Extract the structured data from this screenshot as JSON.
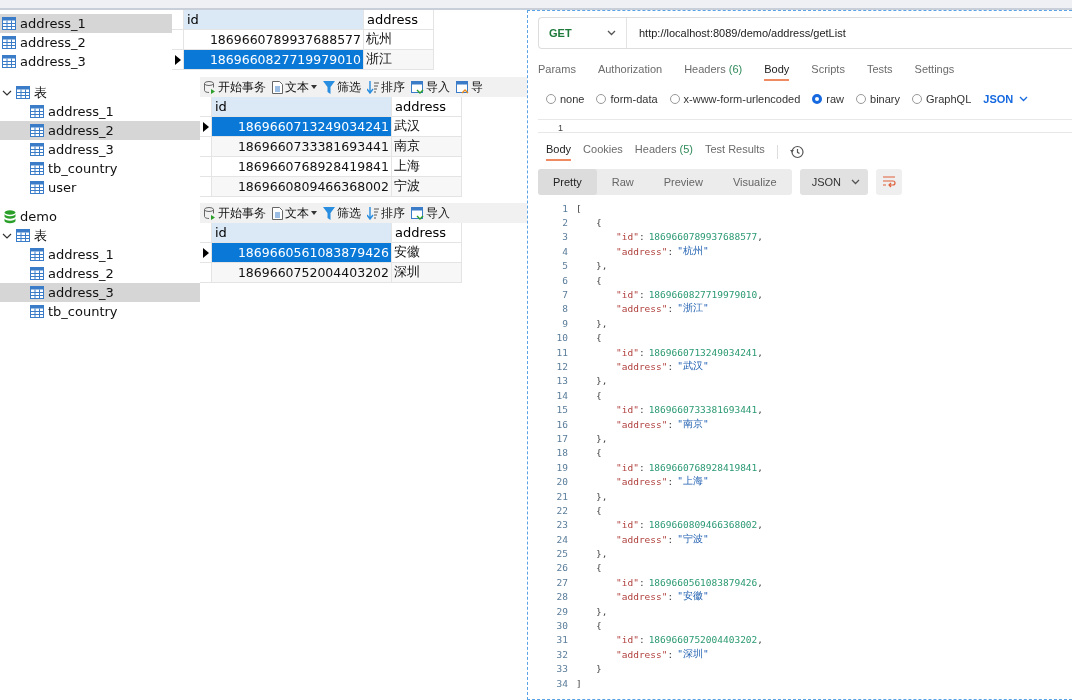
{
  "navicat_panels": [
    {
      "tables": [
        {
          "name": "address_1",
          "selected": true
        },
        {
          "name": "address_2",
          "selected": false
        },
        {
          "name": "address_3",
          "selected": false
        }
      ],
      "columns": [
        "id",
        "address"
      ],
      "rows": [
        {
          "id": "1869660789937688577",
          "address": "杭州",
          "selected": false
        },
        {
          "id": "1869660827719979010",
          "address": "浙江",
          "selected": true
        }
      ]
    },
    {
      "folder": {
        "label": "表",
        "expanded": true
      },
      "tables": [
        {
          "name": "address_1",
          "selected": false
        },
        {
          "name": "address_2",
          "selected": true
        },
        {
          "name": "address_3",
          "selected": false
        },
        {
          "name": "tb_country",
          "selected": false
        },
        {
          "name": "user",
          "selected": false
        }
      ],
      "toolbar": [
        {
          "kind": "transaction",
          "label": "开始事务"
        },
        {
          "kind": "text",
          "label": "文本"
        },
        {
          "kind": "filter",
          "label": "筛选"
        },
        {
          "kind": "sort",
          "label": "排序"
        },
        {
          "kind": "import",
          "label": "导入"
        },
        {
          "kind": "export",
          "label": "导"
        }
      ],
      "columns": [
        "id",
        "address"
      ],
      "rows": [
        {
          "id": "1869660713249034241",
          "address": "武汉",
          "selected": true
        },
        {
          "id": "1869660733381693441",
          "address": "南京",
          "selected": false
        },
        {
          "id": "1869660768928419841",
          "address": "上海",
          "selected": false
        },
        {
          "id": "1869660809466368002",
          "address": "宁波",
          "selected": false
        }
      ]
    },
    {
      "database": "demo",
      "folder": {
        "label": "表",
        "expanded": true
      },
      "tables": [
        {
          "name": "address_1",
          "selected": false
        },
        {
          "name": "address_2",
          "selected": false
        },
        {
          "name": "address_3",
          "selected": true
        },
        {
          "name": "tb_country",
          "selected": false
        }
      ],
      "toolbar": [
        {
          "kind": "transaction",
          "label": "开始事务"
        },
        {
          "kind": "text",
          "label": "文本"
        },
        {
          "kind": "filter",
          "label": "筛选"
        },
        {
          "kind": "sort",
          "label": "排序"
        },
        {
          "kind": "import",
          "label": "导入"
        }
      ],
      "columns": [
        "id",
        "address"
      ],
      "rows": [
        {
          "id": "1869660561083879426",
          "address": "安徽",
          "selected": true
        },
        {
          "id": "1869660752004403202",
          "address": "深圳",
          "selected": false
        }
      ]
    }
  ],
  "postman": {
    "method": "GET",
    "url": "http://localhost:8089/demo/address/getList",
    "request_tabs": [
      {
        "label": "Params",
        "selected": false
      },
      {
        "label": "Authorization",
        "selected": false
      },
      {
        "label": "Headers",
        "count": "(6)",
        "selected": false
      },
      {
        "label": "Body",
        "selected": true
      },
      {
        "label": "Scripts",
        "selected": false
      },
      {
        "label": "Tests",
        "selected": false
      },
      {
        "label": "Settings",
        "selected": false
      }
    ],
    "body_types": [
      {
        "label": "none",
        "selected": false
      },
      {
        "label": "form-data",
        "selected": false
      },
      {
        "label": "x-www-form-urlencoded",
        "selected": false
      },
      {
        "label": "raw",
        "selected": true
      },
      {
        "label": "binary",
        "selected": false
      },
      {
        "label": "GraphQL",
        "selected": false
      }
    ],
    "body_format": "JSON",
    "editor_line": "1",
    "response_tabs": [
      {
        "label": "Body",
        "selected": true
      },
      {
        "label": "Cookies",
        "selected": false
      },
      {
        "label": "Headers",
        "count": "(5)",
        "selected": false
      },
      {
        "label": "Test Results",
        "selected": false
      }
    ],
    "view_modes": [
      {
        "label": "Pretty",
        "selected": true
      },
      {
        "label": "Raw",
        "selected": false
      },
      {
        "label": "Preview",
        "selected": false
      },
      {
        "label": "Visualize",
        "selected": false
      }
    ],
    "response_format": "JSON",
    "code": [
      {
        "no": "1",
        "kind": "outer",
        "parts": [
          {
            "kind": "punct",
            "text": "["
          }
        ]
      },
      {
        "no": "2",
        "kind": "object",
        "parts": [
          {
            "kind": "punct",
            "text": "{"
          }
        ]
      },
      {
        "no": "3",
        "kind": "field",
        "parts": [
          {
            "kind": "key",
            "text": "\"id\""
          },
          {
            "kind": "punct",
            "text": ":"
          },
          {
            "kind": "number",
            "text": "1869660789937688577"
          },
          {
            "kind": "punct",
            "text": ","
          }
        ]
      },
      {
        "no": "4",
        "kind": "field",
        "parts": [
          {
            "kind": "key",
            "text": "\"address\""
          },
          {
            "kind": "punct",
            "text": ":"
          },
          {
            "kind": "string",
            "text": "\"杭州\""
          }
        ]
      },
      {
        "no": "5",
        "kind": "object",
        "parts": [
          {
            "kind": "punct",
            "text": "},"
          }
        ]
      },
      {
        "no": "6",
        "kind": "object",
        "parts": [
          {
            "kind": "punct",
            "text": "{"
          }
        ]
      },
      {
        "no": "7",
        "kind": "field",
        "parts": [
          {
            "kind": "key",
            "text": "\"id\""
          },
          {
            "kind": "punct",
            "text": ":"
          },
          {
            "kind": "number",
            "text": "1869660827719979010"
          },
          {
            "kind": "punct",
            "text": ","
          }
        ]
      },
      {
        "no": "8",
        "kind": "field",
        "parts": [
          {
            "kind": "key",
            "text": "\"address\""
          },
          {
            "kind": "punct",
            "text": ":"
          },
          {
            "kind": "string",
            "text": "\"浙江\""
          }
        ]
      },
      {
        "no": "9",
        "kind": "object",
        "parts": [
          {
            "kind": "punct",
            "text": "},"
          }
        ]
      },
      {
        "no": "10",
        "kind": "object",
        "parts": [
          {
            "kind": "punct",
            "text": "{"
          }
        ]
      },
      {
        "no": "11",
        "kind": "field",
        "parts": [
          {
            "kind": "key",
            "text": "\"id\""
          },
          {
            "kind": "punct",
            "text": ":"
          },
          {
            "kind": "number",
            "text": "1869660713249034241"
          },
          {
            "kind": "punct",
            "text": ","
          }
        ]
      },
      {
        "no": "12",
        "kind": "field",
        "parts": [
          {
            "kind": "key",
            "text": "\"address\""
          },
          {
            "kind": "punct",
            "text": ":"
          },
          {
            "kind": "string",
            "text": "\"武汉\""
          }
        ]
      },
      {
        "no": "13",
        "kind": "object",
        "parts": [
          {
            "kind": "punct",
            "text": "},"
          }
        ]
      },
      {
        "no": "14",
        "kind": "object",
        "parts": [
          {
            "kind": "punct",
            "text": "{"
          }
        ]
      },
      {
        "no": "15",
        "kind": "field",
        "parts": [
          {
            "kind": "key",
            "text": "\"id\""
          },
          {
            "kind": "punct",
            "text": ":"
          },
          {
            "kind": "number",
            "text": "1869660733381693441"
          },
          {
            "kind": "punct",
            "text": ","
          }
        ]
      },
      {
        "no": "16",
        "kind": "field",
        "parts": [
          {
            "kind": "key",
            "text": "\"address\""
          },
          {
            "kind": "punct",
            "text": ":"
          },
          {
            "kind": "string",
            "text": "\"南京\""
          }
        ]
      },
      {
        "no": "17",
        "kind": "object",
        "parts": [
          {
            "kind": "punct",
            "text": "},"
          }
        ]
      },
      {
        "no": "18",
        "kind": "object",
        "parts": [
          {
            "kind": "punct",
            "text": "{"
          }
        ]
      },
      {
        "no": "19",
        "kind": "field",
        "parts": [
          {
            "kind": "key",
            "text": "\"id\""
          },
          {
            "kind": "punct",
            "text": ":"
          },
          {
            "kind": "number",
            "text": "1869660768928419841"
          },
          {
            "kind": "punct",
            "text": ","
          }
        ]
      },
      {
        "no": "20",
        "kind": "field",
        "parts": [
          {
            "kind": "key",
            "text": "\"address\""
          },
          {
            "kind": "punct",
            "text": ":"
          },
          {
            "kind": "string",
            "text": "\"上海\""
          }
        ]
      },
      {
        "no": "21",
        "kind": "object",
        "parts": [
          {
            "kind": "punct",
            "text": "},"
          }
        ]
      },
      {
        "no": "22",
        "kind": "object",
        "parts": [
          {
            "kind": "punct",
            "text": "{"
          }
        ]
      },
      {
        "no": "23",
        "kind": "field",
        "parts": [
          {
            "kind": "key",
            "text": "\"id\""
          },
          {
            "kind": "punct",
            "text": ":"
          },
          {
            "kind": "number",
            "text": "1869660809466368002"
          },
          {
            "kind": "punct",
            "text": ","
          }
        ]
      },
      {
        "no": "24",
        "kind": "field",
        "parts": [
          {
            "kind": "key",
            "text": "\"address\""
          },
          {
            "kind": "punct",
            "text": ":"
          },
          {
            "kind": "string",
            "text": "\"宁波\""
          }
        ]
      },
      {
        "no": "25",
        "kind": "object",
        "parts": [
          {
            "kind": "punct",
            "text": "},"
          }
        ]
      },
      {
        "no": "26",
        "kind": "object",
        "parts": [
          {
            "kind": "punct",
            "text": "{"
          }
        ]
      },
      {
        "no": "27",
        "kind": "field",
        "parts": [
          {
            "kind": "key",
            "text": "\"id\""
          },
          {
            "kind": "punct",
            "text": ":"
          },
          {
            "kind": "number",
            "text": "1869660561083879426"
          },
          {
            "kind": "punct",
            "text": ","
          }
        ]
      },
      {
        "no": "28",
        "kind": "field",
        "parts": [
          {
            "kind": "key",
            "text": "\"address\""
          },
          {
            "kind": "punct",
            "text": ":"
          },
          {
            "kind": "string",
            "text": "\"安徽\""
          }
        ]
      },
      {
        "no": "29",
        "kind": "object",
        "parts": [
          {
            "kind": "punct",
            "text": "},"
          }
        ]
      },
      {
        "no": "30",
        "kind": "object",
        "parts": [
          {
            "kind": "punct",
            "text": "{"
          }
        ]
      },
      {
        "no": "31",
        "kind": "field",
        "parts": [
          {
            "kind": "key",
            "text": "\"id\""
          },
          {
            "kind": "punct",
            "text": ":"
          },
          {
            "kind": "number",
            "text": "1869660752004403202"
          },
          {
            "kind": "punct",
            "text": ","
          }
        ]
      },
      {
        "no": "32",
        "kind": "field",
        "parts": [
          {
            "kind": "key",
            "text": "\"address\""
          },
          {
            "kind": "punct",
            "text": ":"
          },
          {
            "kind": "string",
            "text": "\"深圳\""
          }
        ]
      },
      {
        "no": "33",
        "kind": "object",
        "parts": [
          {
            "kind": "punct",
            "text": "}"
          }
        ]
      },
      {
        "no": "34",
        "kind": "outer",
        "parts": [
          {
            "kind": "punct",
            "text": "]"
          }
        ]
      }
    ]
  }
}
